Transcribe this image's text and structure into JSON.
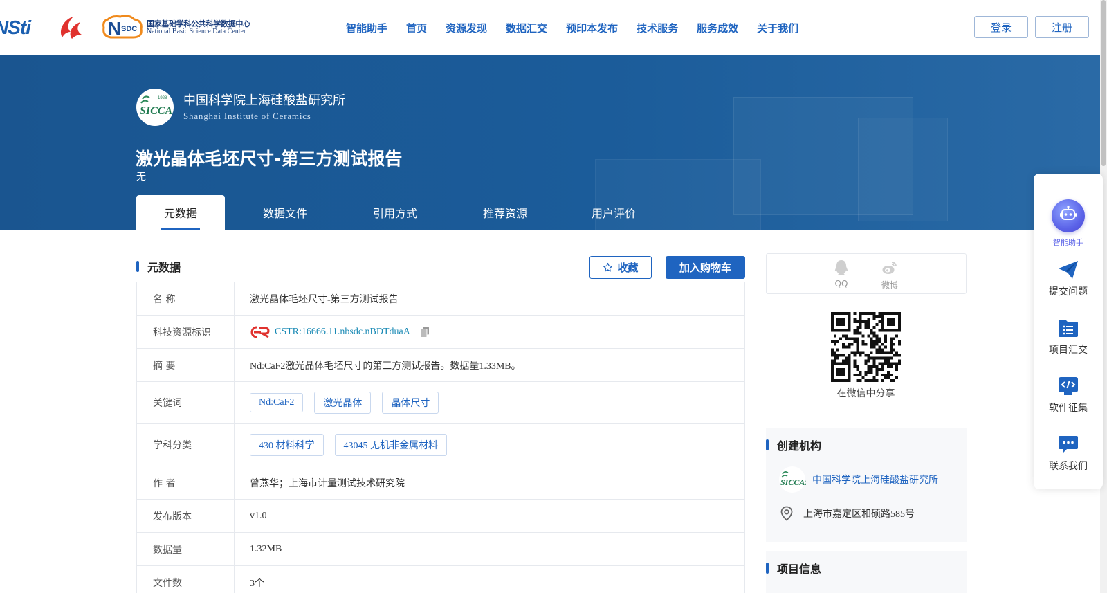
{
  "header": {
    "nsdc_cn": "国家基础学科公共科学数据中心",
    "nsdc_en": "National Basic Science Data Center",
    "nav": [
      "智能助手",
      "首页",
      "资源发现",
      "数据汇交",
      "预印本发布",
      "技术服务",
      "服务成效",
      "关于我们"
    ],
    "login": "登录",
    "register": "注册"
  },
  "banner": {
    "institution_cn": "中国科学院上海硅酸盐研究所",
    "institution_en": "Shanghai Institute of Ceramics",
    "title": "激光晶体毛坯尺寸-第三方测试报告",
    "subtitle": "无",
    "tabs": [
      "元数据",
      "数据文件",
      "引用方式",
      "推荐资源",
      "用户评价"
    ],
    "active_tab": 0
  },
  "metadata": {
    "section_title": "元数据",
    "favorite_label": "收藏",
    "cart_label": "加入购物车",
    "rows": {
      "name": {
        "label": "名  称",
        "value": "激光晶体毛坯尺寸-第三方测试报告"
      },
      "cstr": {
        "label": "科技资源标识",
        "value": "CSTR:16666.11.nbsdc.nBDTduaA"
      },
      "abstract": {
        "label": "摘  要",
        "value": "Nd:CaF2激光晶体毛坯尺寸的第三方测试报告。数据量1.33MB。"
      },
      "keywords": {
        "label": "关键词",
        "values": [
          "Nd:CaF2",
          "激光晶体",
          "晶体尺寸"
        ]
      },
      "subjects": {
        "label": "学科分类",
        "values": [
          "430 材料科学",
          "43045 无机非金属材料"
        ]
      },
      "authors": {
        "label": "作  者",
        "value": "曾燕华；上海市计量测试技术研究院"
      },
      "version": {
        "label": "发布版本",
        "value": "v1.0"
      },
      "size": {
        "label": "数据量",
        "value": "1.32MB"
      },
      "files": {
        "label": "文件数",
        "value": "3个"
      }
    }
  },
  "share": {
    "qq": "QQ",
    "weibo": "微博",
    "wechat_caption": "在微信中分享"
  },
  "creator": {
    "title": "创建机构",
    "org": "中国科学院上海硅酸盐研究所",
    "address": "上海市嘉定区和硕路585号"
  },
  "project": {
    "title": "项目信息"
  },
  "float_bar": {
    "ai": "智能助手",
    "submit": "提交问题",
    "projects": "项目汇交",
    "software": "软件征集",
    "contact": "联系我们"
  },
  "colors": {
    "primary": "#1f64c0",
    "banner": "#1b5c9a",
    "ai_accent": "#5b63e8"
  }
}
